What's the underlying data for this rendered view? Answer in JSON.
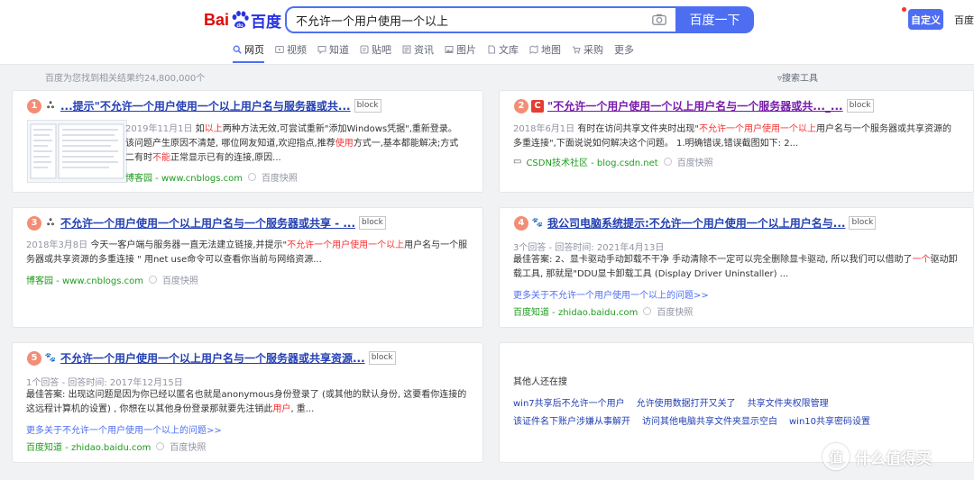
{
  "logo": {
    "bai": "Bai",
    "du": "du",
    "cn": "百度"
  },
  "search": {
    "query": "不允许一个用户使用一个以上",
    "button": "百度一下"
  },
  "header_right": {
    "custom": "自定义",
    "home": "百度首页"
  },
  "tabs": [
    {
      "label": "网页",
      "icon": "search-icon"
    },
    {
      "label": "视频",
      "icon": "video-icon"
    },
    {
      "label": "知道",
      "icon": "zhidao-icon"
    },
    {
      "label": "贴吧",
      "icon": "tieba-icon"
    },
    {
      "label": "资讯",
      "icon": "news-icon"
    },
    {
      "label": "图片",
      "icon": "image-icon"
    },
    {
      "label": "文库",
      "icon": "wenku-icon"
    },
    {
      "label": "地图",
      "icon": "map-icon"
    },
    {
      "label": "采购",
      "icon": "purchase-icon"
    },
    {
      "label": "更多",
      "icon": ""
    }
  ],
  "result_count": "百度为您找到相关结果约24,800,000个",
  "search_tools": "搜索工具",
  "block": "block",
  "snapshot": "百度快照",
  "results": [
    {
      "num": "1",
      "title": "...提示\"不允许一个用户使用一个以上用户名与服务器或共...",
      "date": "2019年11月1日",
      "abstract_html": "如<span class='hl'>以上</span>两种方法无效,可尝试重新\"添加Windows凭据\",重新登录。 该问题产生原因不清楚, 哪位网友知道,欢迎指点,推荐<span class='hl'>使用</span>方式一,基本都能解决;方式二有时<span class='hl'>不能</span>正常显示已有的连接,原因...",
      "source": "博客园 - www.cnblogs.com"
    },
    {
      "num": "2",
      "title": "\"不允许一个用户使用一个以上用户名与一个服务器或共..._...",
      "date": "2018年6月1日",
      "abstract_html": "有时在访问共享文件夹时出现\"<span class='hl'>不允许一个用户使用一个以上</span>用户名与一个服务器或共享资源的多重连接\",下面说说如何解决这个问题。 1.明确错误,错误截图如下: 2...",
      "source": "CSDN技术社区 - blog.csdn.net"
    },
    {
      "num": "3",
      "title": "不允许一个用户使用一个以上用户名与一个服务器或共享 - ...",
      "date": "2018年3月8日",
      "abstract_html": "今天一客户端与服务器一直无法建立链接,并提示\"<span class='hl'>不允许一个用户使用一个以上</span>用户名与一个服务器或共享资源的多重连接 \" 用net use命令可以查看你当前与网络资源...",
      "source": "博客园 - www.cnblogs.com"
    },
    {
      "num": "4",
      "title": "我公司电脑系统提示:不允许一个用户使用一个以上用户名与...",
      "meta": "3个回答 - 回答时间: 2021年4月13日",
      "abstract_html": "最佳答案: 2、显卡驱动手动卸载不干净 手动清除不一定可以完全删除显卡驱动, 所以我们可以借助了<span class='hl'>一个</span>驱动卸载工具, 那就是\"DDU显卡卸载工具 (Display Driver Uninstaller) ...",
      "more": "更多关于不允许一个用户使用一个以上的问题>>",
      "source": "百度知道 - zhidao.baidu.com"
    },
    {
      "num": "5",
      "title": "不允许一个用户使用一个以上用户名与一个服务器或共享资源...",
      "meta": "1个回答 - 回答时间: 2017年12月15日",
      "abstract_html": "最佳答案: 出现这问题是因为你已经以匿名也就是anonymous身份登录了 (或其他的默认身份, 这要看你连接的这远程计算机的设置) , 你想在以其他身份登录那就要先注销此<span class='hl'>用户</span>, 重...",
      "more": "更多关于不允许一个用户使用一个以上的问题>>",
      "source": "百度知道 - zhidao.baidu.com"
    }
  ],
  "others": {
    "title": "其他人还在搜",
    "row1": [
      "win7共享后不允许一个用户",
      "允许使用数据打开又关了",
      "共享文件夹权限管理"
    ],
    "row2": [
      "该证件名下账户涉嫌从事解开",
      "访问其他电脑共享文件夹显示空白",
      "win10共享密码设置"
    ]
  },
  "watermark": {
    "icon": "值",
    "text": "什么值得买"
  },
  "colors": {
    "brand_blue": "#4e6ef2",
    "link": "#2440b3",
    "visited": "#771caa",
    "highlight": "#f73131",
    "source_green": "#1e9c1e",
    "badge": "#f38d76"
  }
}
